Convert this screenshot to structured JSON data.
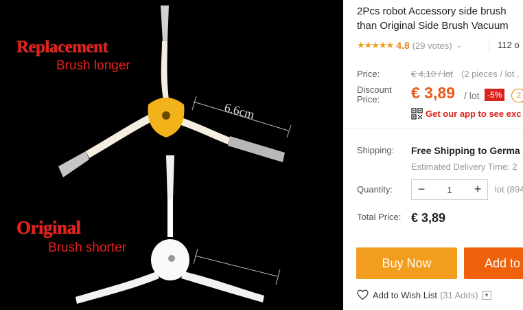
{
  "product_image": {
    "replacement_title": "Replacement",
    "replacement_subtitle": "Brush longer",
    "original_title": "Original",
    "original_subtitle": "Brush shorter",
    "measurement": "6.6cm"
  },
  "product": {
    "title_line1": "2Pcs robot Accessory side brush",
    "title_line2": "than Original Side Brush Vacuum"
  },
  "rating": {
    "stars": "★★★★★",
    "value": "4.8",
    "votes": "(29 votes)",
    "orders": "112 o"
  },
  "pricing": {
    "price_label": "Price:",
    "old_price": "€ 4,10 / lot",
    "pieces_note": "(2 pieces / lot ,",
    "discount_label": "Discount Price:",
    "current_price": "€ 3,89",
    "per_lot": "/ lot",
    "discount_badge": "-5%",
    "badge_2": "2",
    "app_promo": "Get our app to see exc"
  },
  "shipping": {
    "label": "Shipping:",
    "value": "Free Shipping to Germa",
    "delivery": "Estimated Delivery Time: 2"
  },
  "quantity": {
    "label": "Quantity:",
    "minus": "−",
    "value": "1",
    "plus": "+",
    "lots_available": "lot (894"
  },
  "total": {
    "label": "Total Price:",
    "value": "€ 3,89"
  },
  "actions": {
    "buy_now": "Buy Now",
    "add_to_cart": "Add to",
    "wishlist": "Add to Wish List",
    "wishlist_count": "(31 Adds)"
  },
  "colors": {
    "accent_orange": "#f39d1f",
    "cart_orange": "#f0610b",
    "price_red": "#e8591a",
    "badge_red": "#d9231d",
    "star_color": "#f29b1d"
  },
  "icons": {
    "qr": "qr-code-icon",
    "heart": "heart-icon",
    "chevron": "chevron-down-icon"
  }
}
